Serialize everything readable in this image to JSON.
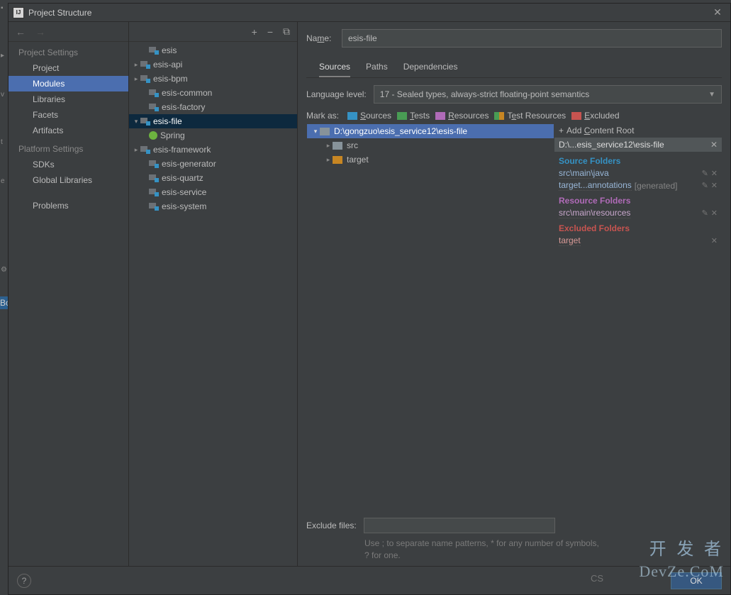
{
  "title": "Project Structure",
  "leftNav": {
    "sectionA": "Project Settings",
    "items": [
      "Project",
      "Modules",
      "Libraries",
      "Facets",
      "Artifacts"
    ],
    "selected": "Modules",
    "sectionB": "Platform Settings",
    "itemsB": [
      "SDKs",
      "Global Libraries"
    ],
    "problems": "Problems"
  },
  "modules": {
    "root": "esis",
    "children": [
      "esis-api",
      "esis-bpm",
      "esis-common",
      "esis-factory",
      "esis-file",
      "esis-framework",
      "esis-generator",
      "esis-quartz",
      "esis-service",
      "esis-system"
    ],
    "selected": "esis-file",
    "spring": "Spring"
  },
  "right": {
    "nameLabel": "Name:",
    "nameValue": "esis-file",
    "tabs": [
      "Sources",
      "Paths",
      "Dependencies"
    ],
    "activeTab": "Sources",
    "langLabel": "Language level:",
    "langValue": "17 - Sealed types, always-strict floating-point semantics",
    "markLabel": "Mark as:",
    "markItems": {
      "sources": "Sources",
      "tests": "Tests",
      "resources": "Resources",
      "testRes": "Test Resources",
      "excluded": "Excluded"
    },
    "srcRoot": "D:\\gongzuo\\esis_service12\\esis-file",
    "srcTree": [
      "src",
      "target"
    ],
    "addContent": "Add Content Root",
    "contentPath": "D:\\...esis_service12\\esis-file",
    "sourceFoldersHdr": "Source Folders",
    "sourceFolders": [
      {
        "path": "src\\main\\java",
        "gen": ""
      },
      {
        "path": "target...annotations",
        "gen": "[generated]"
      }
    ],
    "resourceFoldersHdr": "Resource Folders",
    "resourceFolders": [
      {
        "path": "src\\main\\resources"
      }
    ],
    "excludedFoldersHdr": "Excluded Folders",
    "excludedFolders": [
      {
        "path": "target"
      }
    ],
    "excludeLabel": "Exclude files:",
    "hint": "Use ; to separate name patterns, * for any number of symbols, ? for one."
  },
  "footer": {
    "ok": "OK",
    "help": "?"
  },
  "watermark": {
    "cn": "开 发 者",
    "en": "DevZe.CoM",
    "cs": "CS"
  }
}
